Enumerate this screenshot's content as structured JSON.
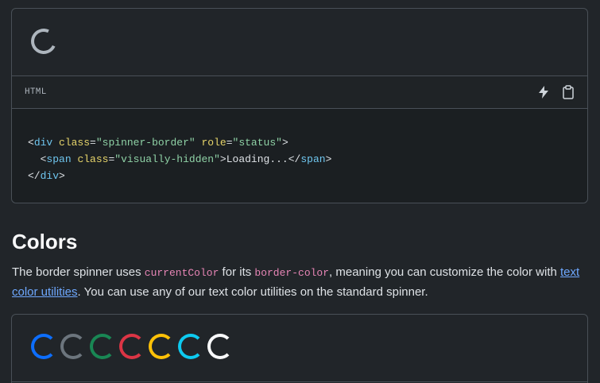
{
  "example1": {
    "code_lang": "HTML",
    "code_lines": [
      {
        "indent": "",
        "open": "<",
        "tag": "div",
        "attrs": [
          {
            "name": "class",
            "value": "\"spinner-border\""
          },
          {
            "name": "role",
            "value": "\"status\""
          }
        ],
        "close": ">"
      },
      {
        "indent": "  ",
        "open": "<",
        "tag": "span",
        "attrs": [
          {
            "name": "class",
            "value": "\"visually-hidden\""
          }
        ],
        "close": ">",
        "text": "Loading...",
        "end_tag": "span"
      },
      {
        "indent": "",
        "end_tag": "div"
      }
    ]
  },
  "section": {
    "heading": "Colors",
    "desc_part1": "The border spinner uses ",
    "code1": "currentColor",
    "desc_part2": " for its ",
    "code2": "border-color",
    "desc_part3": ", meaning you can customize the color with ",
    "link": "text color utilities",
    "desc_part4": ". You can use any of our text color utilities on the standard spinner."
  },
  "colors": {
    "primary": "#0d6efd",
    "secondary": "#6c757d",
    "success": "#198754",
    "danger": "#dc3545",
    "warning": "#ffc107",
    "info": "#0dcaf0",
    "light": "#f8f9fa"
  }
}
